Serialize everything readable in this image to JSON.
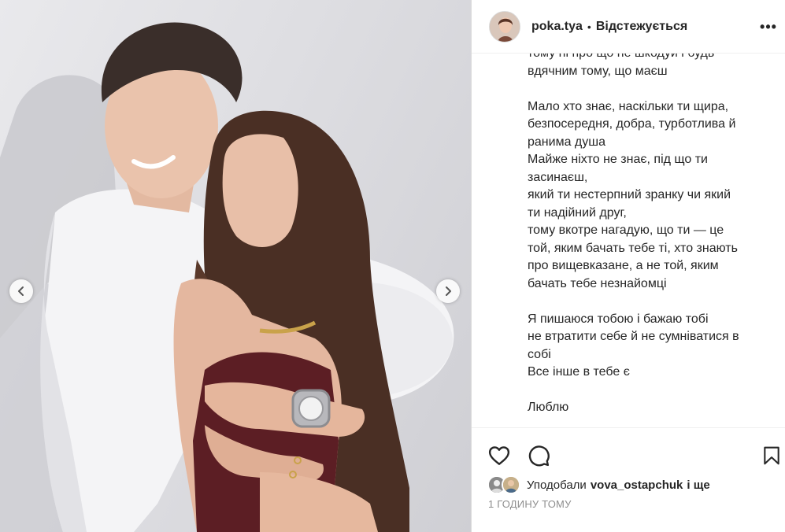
{
  "post": {
    "username": "poka.tya",
    "separator": "•",
    "follow_state": "Відстежується",
    "more_label": "•••"
  },
  "caption": {
    "paragraph_1": "тому ні про що не шкодуй і будь\nвдячним тому, що маєш",
    "paragraph_2": "Мало хто знає, наскільки ти щира,\nбезпосередня, добра, турботлива й\nранима душа\nМайже ніхто не знає, під що ти\nзасинаєш,\nякий ти нестерпний зранку чи який\nти надійний друг,\nтому вкотре нагадую, що ти — це\nтой, яким бачать тебе ті, хто знають\nпро вищевказане, а не той, яким\nбачать тебе незнайомці",
    "paragraph_3": "Я пишаюся тобою і бажаю тобі\nне втратити себе й не сумніватися в\nсобі\nВсе інше в тебе є",
    "paragraph_4": "Люблю"
  },
  "actions": {
    "like_icon": "heart-icon",
    "comment_icon": "comment-icon",
    "save_icon": "bookmark-icon"
  },
  "likes": {
    "prefix": "Уподобали",
    "user": "vova_ostapchuk",
    "suffix": "і ще"
  },
  "timestamp": "1 ГОДИНУ ТОМУ",
  "carousel": {
    "prev_icon": "chevron-left-icon",
    "next_icon": "chevron-right-icon"
  },
  "colors": {
    "text": "#262626",
    "muted": "#8e8e8e",
    "border": "#dbdbdb"
  }
}
